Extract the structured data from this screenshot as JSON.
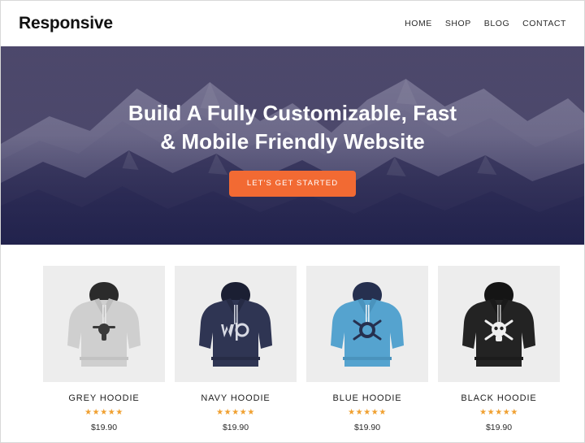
{
  "header": {
    "brand": "Responsive",
    "nav": [
      {
        "label": "HOME"
      },
      {
        "label": "SHOP"
      },
      {
        "label": "BLOG"
      },
      {
        "label": "CONTACT"
      }
    ]
  },
  "hero": {
    "title": "Build A Fully Customizable, Fast & Mobile Friendly Website",
    "cta_label": "LET'S GET STARTED",
    "background_image": "mountain-range-photo",
    "overlay_color_top": "#464268",
    "overlay_color_bottom": "#232450",
    "accent_color": "#f26a33"
  },
  "products": {
    "star_glyphs": "★★★★★",
    "items": [
      {
        "title": "GREY HOODIE",
        "price": "$19.90",
        "rating": 5,
        "image": "grey-hoodie-image",
        "garment_color": "#cfcfcf",
        "hood_color": "#2b2b2b",
        "graphic_color": "#3a3a3a"
      },
      {
        "title": "NAVY HOODIE",
        "price": "$19.90",
        "rating": 5,
        "image": "navy-hoodie-image",
        "garment_color": "#2f3553",
        "hood_color": "#1b1f33",
        "graphic_color": "#d8dae4"
      },
      {
        "title": "BLUE HOODIE",
        "price": "$19.90",
        "rating": 5,
        "image": "blue-hoodie-image",
        "garment_color": "#55a3cf",
        "hood_color": "#26304f",
        "graphic_color": "#26304f"
      },
      {
        "title": "BLACK HOODIE",
        "price": "$19.90",
        "rating": 5,
        "image": "black-hoodie-image",
        "garment_color": "#232323",
        "hood_color": "#151515",
        "graphic_color": "#efefef"
      }
    ]
  }
}
